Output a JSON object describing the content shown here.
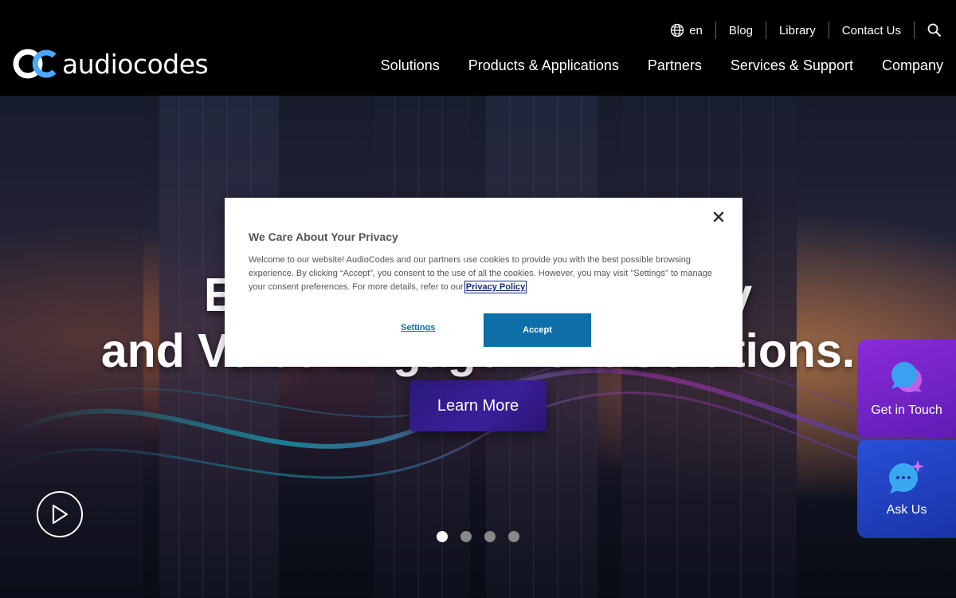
{
  "brand": {
    "logo_text": "audiocodes",
    "accent": "#4aa8ff"
  },
  "utility_nav": {
    "language": "en",
    "items": [
      {
        "label": "Blog"
      },
      {
        "label": "Library"
      },
      {
        "label": "Contact Us"
      }
    ],
    "search_icon": "search-icon"
  },
  "main_nav": {
    "items": [
      {
        "label": "Solutions"
      },
      {
        "label": "Products & Applications"
      },
      {
        "label": "Partners"
      },
      {
        "label": "Services & Support"
      },
      {
        "label": "Company"
      }
    ]
  },
  "hero": {
    "title_line1": "End-to-End Connectivity",
    "title_line2": "and Voice Engagement Solutions.",
    "cta_label": "Learn More",
    "play_icon": "play-icon",
    "slides": 4,
    "active_slide": 1
  },
  "side_widgets": {
    "get_in_touch": {
      "label": "Get in Touch",
      "color": "#7a25cc"
    },
    "ask_us": {
      "label": "Ask Us",
      "color": "#2244c4"
    }
  },
  "cookie_modal": {
    "title": "We Care About Your Privacy",
    "body": "Welcome to our website! AudioCodes and our partners use cookies to provide you with the best possible browsing experience. By clicking “Accept”, you consent to the use of all the cookies. However, you may visit \"Settings\" to manage your consent preferences. For more details, refer to our",
    "privacy_link": "Privacy Policy",
    "settings_label": "Settings",
    "accept_label": "Accept",
    "accept_color": "#0d6ea8"
  }
}
